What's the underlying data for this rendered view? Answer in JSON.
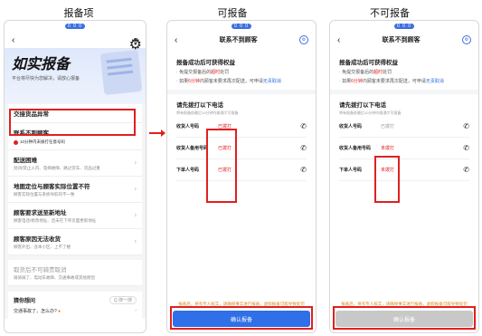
{
  "captions": [
    "报备项",
    "可报备",
    "不可报备"
  ],
  "status_pill": "0 0 0",
  "left": {
    "nav_right": "易",
    "hero_title": "如实报备",
    "hero_sub": "平台将尽快为您解决，请放心报备",
    "items": [
      {
        "title": "交接货品异常",
        "desc": ""
      },
      {
        "title": "联系不到顾客",
        "desc": "10分钟内未拨打任意号码",
        "warn": true
      },
      {
        "title": "配送困难",
        "desc": "封闭/禁止入内、电梯故障、路过货车、货品过重"
      },
      {
        "title": "地图定位与顾客实际位置不符",
        "desc": "顾客实际位置与系统导航的不一致"
      },
      {
        "title": "顾客要求送至新地址",
        "desc": "顾客电话/修改地址、且未在下单页面更新地址"
      },
      {
        "title": "顾客原因无法收货",
        "desc": "顾客外出、含本小区、上不了楼"
      }
    ],
    "dim_item": {
      "title": "取货后不可骑责取消",
      "desc": "骑骑骑了、电动车故障、交通事故或其他原因"
    },
    "help_title": "猜你想问",
    "help_search": "Q 搜一搜",
    "help_q": "交通事故了，怎么办?"
  },
  "detail": {
    "title": "联系不到顾客",
    "benefit_title": "报备成功后可获得权益",
    "b1_pre": "免提交报备后的",
    "b1_red": "超时",
    "b1_post": "处罚",
    "b2_pre": "如果",
    "b2_red": "6分钟",
    "b2_mid": "内顾客未要求再次配送，可申请",
    "b2_blue": "无责取消",
    "call_title": "请先拨打以下电话",
    "call_note": "将有报备前最后10分钟内拨通才可报备",
    "rows": [
      {
        "name": "收货人号码",
        "status_ok": "已拨打",
        "status_bad": "未拨打"
      },
      {
        "name": "收货人备用号码",
        "status_ok": "已拨打",
        "status_bad": "未拨打"
      },
      {
        "name": "下单人号码",
        "status_ok": "已拨打",
        "status_bad": "未拨打"
      }
    ],
    "footer": "报备后，将有专人核实，请确保事实进行报备，虚假报备可能导致处罚",
    "confirm": "确认报备"
  },
  "colors": {
    "accent": "#3d6fe0",
    "confirm_active": "#2f6fe8",
    "confirm_disabled": "#c8c8c8",
    "highlight": "#e02020"
  }
}
